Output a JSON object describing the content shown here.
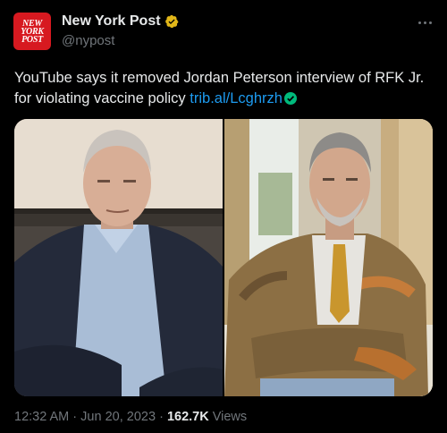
{
  "account": {
    "name": "New York Post",
    "handle": "@nypost",
    "logo_lines": [
      "NEW",
      "YORK",
      "POST"
    ],
    "logo_color": "#d71920",
    "verified_badge_color": "#e2b719"
  },
  "tweet": {
    "text": "YouTube says it removed Jordan Peterson interview of RFK Jr. for violating vaccine policy",
    "link": "trib.al/Lcghrzh",
    "link_color": "#1d9bf0"
  },
  "meta": {
    "time": "12:32 AM",
    "separator": "·",
    "date": "Jun 20, 2023",
    "views_count": "162.7K",
    "views_label": "Views"
  },
  "icons": {
    "more": "more-horizontal-icon",
    "verified": "gold-verified-badge-icon",
    "link_check": "green-check-icon"
  }
}
